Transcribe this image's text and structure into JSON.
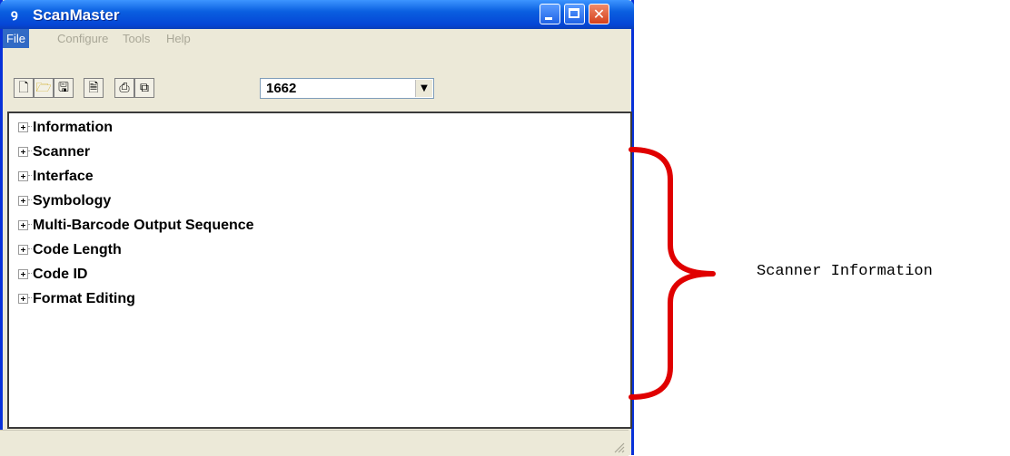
{
  "window": {
    "title": "ScanMaster",
    "app_icon": "scanner-icon"
  },
  "menu": {
    "items": [
      "File",
      "Configure",
      "Tools",
      "Help"
    ],
    "active": "File"
  },
  "toolbar": {
    "buttons": [
      "new-icon",
      "open-icon",
      "save-icon",
      "properties-icon",
      "print-icon",
      "copy-icon"
    ],
    "model_select_value": "1662"
  },
  "tree": {
    "items": [
      "Information",
      "Scanner",
      "Interface",
      "Symbology",
      "Multi-Barcode Output Sequence",
      "Code Length",
      "Code ID",
      "Format Editing"
    ]
  },
  "annotation": {
    "text": "Scanner Information",
    "brace_color": "#e00000"
  }
}
